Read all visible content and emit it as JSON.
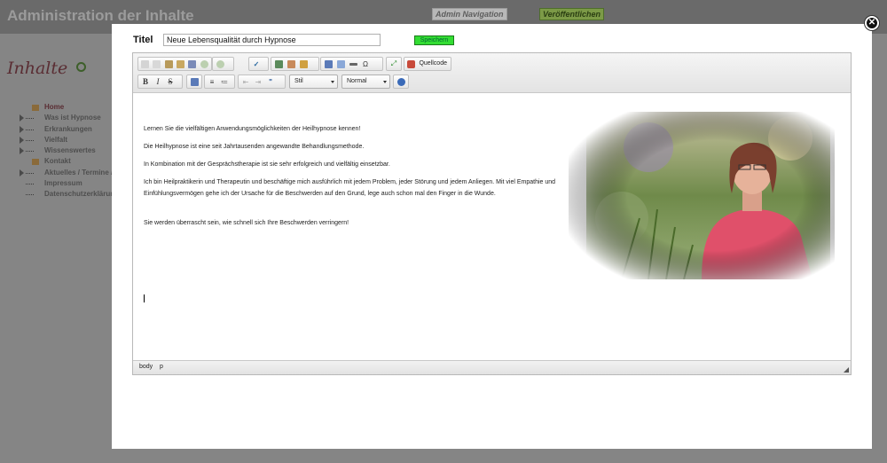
{
  "admin": {
    "title": "Administration der Inhalte",
    "nav_button": "Admin Navigation",
    "publish_button": "Veröffentlichen"
  },
  "sidebar": {
    "heading": "Inhalte",
    "items": [
      {
        "label": "Home",
        "current": true,
        "icon": "home-icon"
      },
      {
        "label": "Was ist Hypnose",
        "expandable": true
      },
      {
        "label": "Erkrankungen",
        "expandable": true
      },
      {
        "label": "Vielfalt",
        "expandable": true
      },
      {
        "label": "Wissenswertes",
        "expandable": true
      },
      {
        "label": "Kontakt",
        "icon": "envelope-icon"
      },
      {
        "label": "Aktuelles / Termine / A",
        "expandable": true
      },
      {
        "label": "Impressum"
      },
      {
        "label": "Datenschutzerklärung"
      }
    ]
  },
  "form": {
    "title_label": "Titel",
    "title_value": "Neue Lebensqualität durch Hypnose",
    "save_label": "Speichern"
  },
  "editor": {
    "source_label": "Quellcode",
    "style_combo": "Stil",
    "format_combo": "Normal",
    "paragraphs": [
      "Lernen Sie die vielfältigen Anwendungsmöglichkeiten der Heilhypnose kennen!",
      "Die Heilhypnose ist eine seit Jahrtausenden angewandte Behandlungsmethode.",
      "In Kombination mit der Gesprächstherapie ist sie sehr erfolgreich und vielfältig einsetzbar.",
      "Ich bin Heilpraktikerin und Therapeutin und beschäftige mich ausführlich mit jedem Problem, jeder Störung und jedem Anliegen. Mit viel Empathie und Einfühlungsvermögen gehe ich der Ursache für die Beschwerden auf den Grund, lege auch schon mal den Finger in die Wunde.",
      "Sie werden überrascht sein, wie schnell sich Ihre Beschwerden verringern!"
    ],
    "status_path": [
      "body",
      "p"
    ]
  },
  "colors": {
    "save_green": "#33dd33",
    "heading_maroon": "#5a2d33"
  }
}
